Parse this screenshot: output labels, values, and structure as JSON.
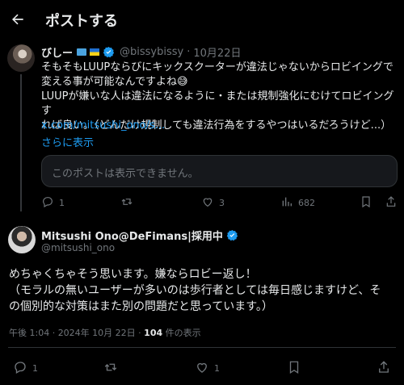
{
  "header": {
    "title": "ポストする"
  },
  "tweet1": {
    "name": "びしー",
    "handle": "@bissybissy",
    "sep": "·",
    "date": "10月22日",
    "lines": [
      "そもそもLUUPならびにキックスクーターが違法じゃないからロビイングで",
      "変える事が可能なんですよね😅",
      "LUUPが嫌いな人は違法になるように・または規制強化にむけてロビイングす",
      "れば良い。（どんだけ規制しても違法行為をするやつはいるだろうけど...）"
    ],
    "link": "x.com/mitsushi_ono/s...",
    "show_more": "さらに表示",
    "quote_text": "このポストは表示できません。",
    "stats": {
      "replies": "1",
      "retweets": "",
      "likes": "3",
      "views": "682"
    }
  },
  "tweet2": {
    "name": "Mitsushi Ono@DeFimans|採用中",
    "handle": "@mitsushi_ono",
    "lines": [
      "めちゃくちゃそう思います。嫌ならロビー返し！",
      "（モラルの無いユーザーが多いのは歩行者としては毎日感じますけど、そ",
      "の個別的な対策はまた別の問題だと思っています。）"
    ],
    "time": "午後 1:04 · 2024年 10月 22日 ·",
    "views": "104",
    "views_label": "件の表示",
    "stats": {
      "replies": "1",
      "likes": "1"
    }
  },
  "colors": {
    "accent": "#1d9bf0",
    "muted": "#71767b",
    "text": "#e7e9ea",
    "bg": "#000000"
  }
}
